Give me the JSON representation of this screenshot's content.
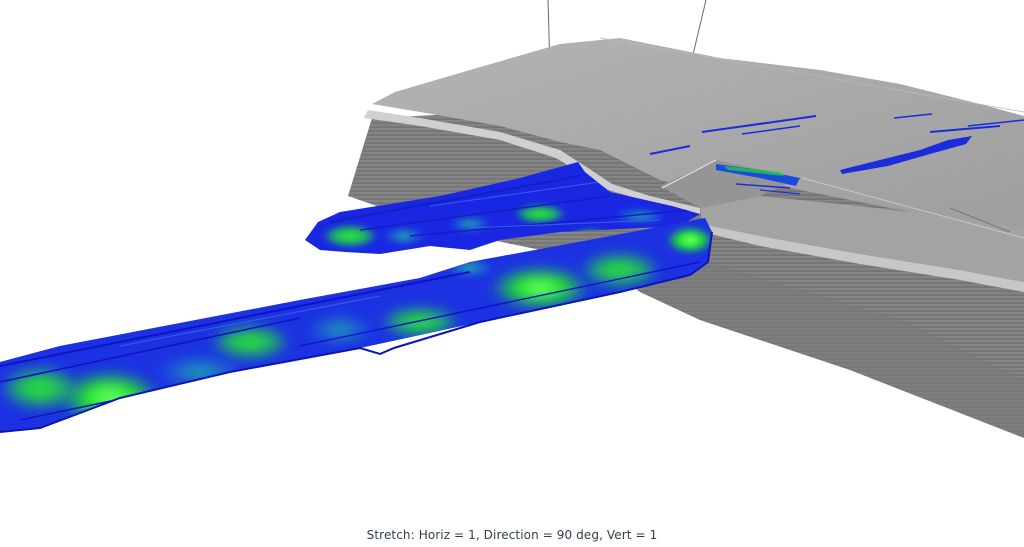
{
  "viewer": {
    "stretch_caption": "Stretch: Horiz = 1, Direction = 90 deg, Vert = 1"
  },
  "colors": {
    "background": "#ffffff",
    "surface_top": "#a9a9a9",
    "surface_side": "#808080",
    "surface_edge": "#c4c4c4",
    "property_low": "#1a1fe0",
    "property_mid": "#1e8fd0",
    "property_high": "#22ee22",
    "caption_text": "#2f3e4e"
  }
}
